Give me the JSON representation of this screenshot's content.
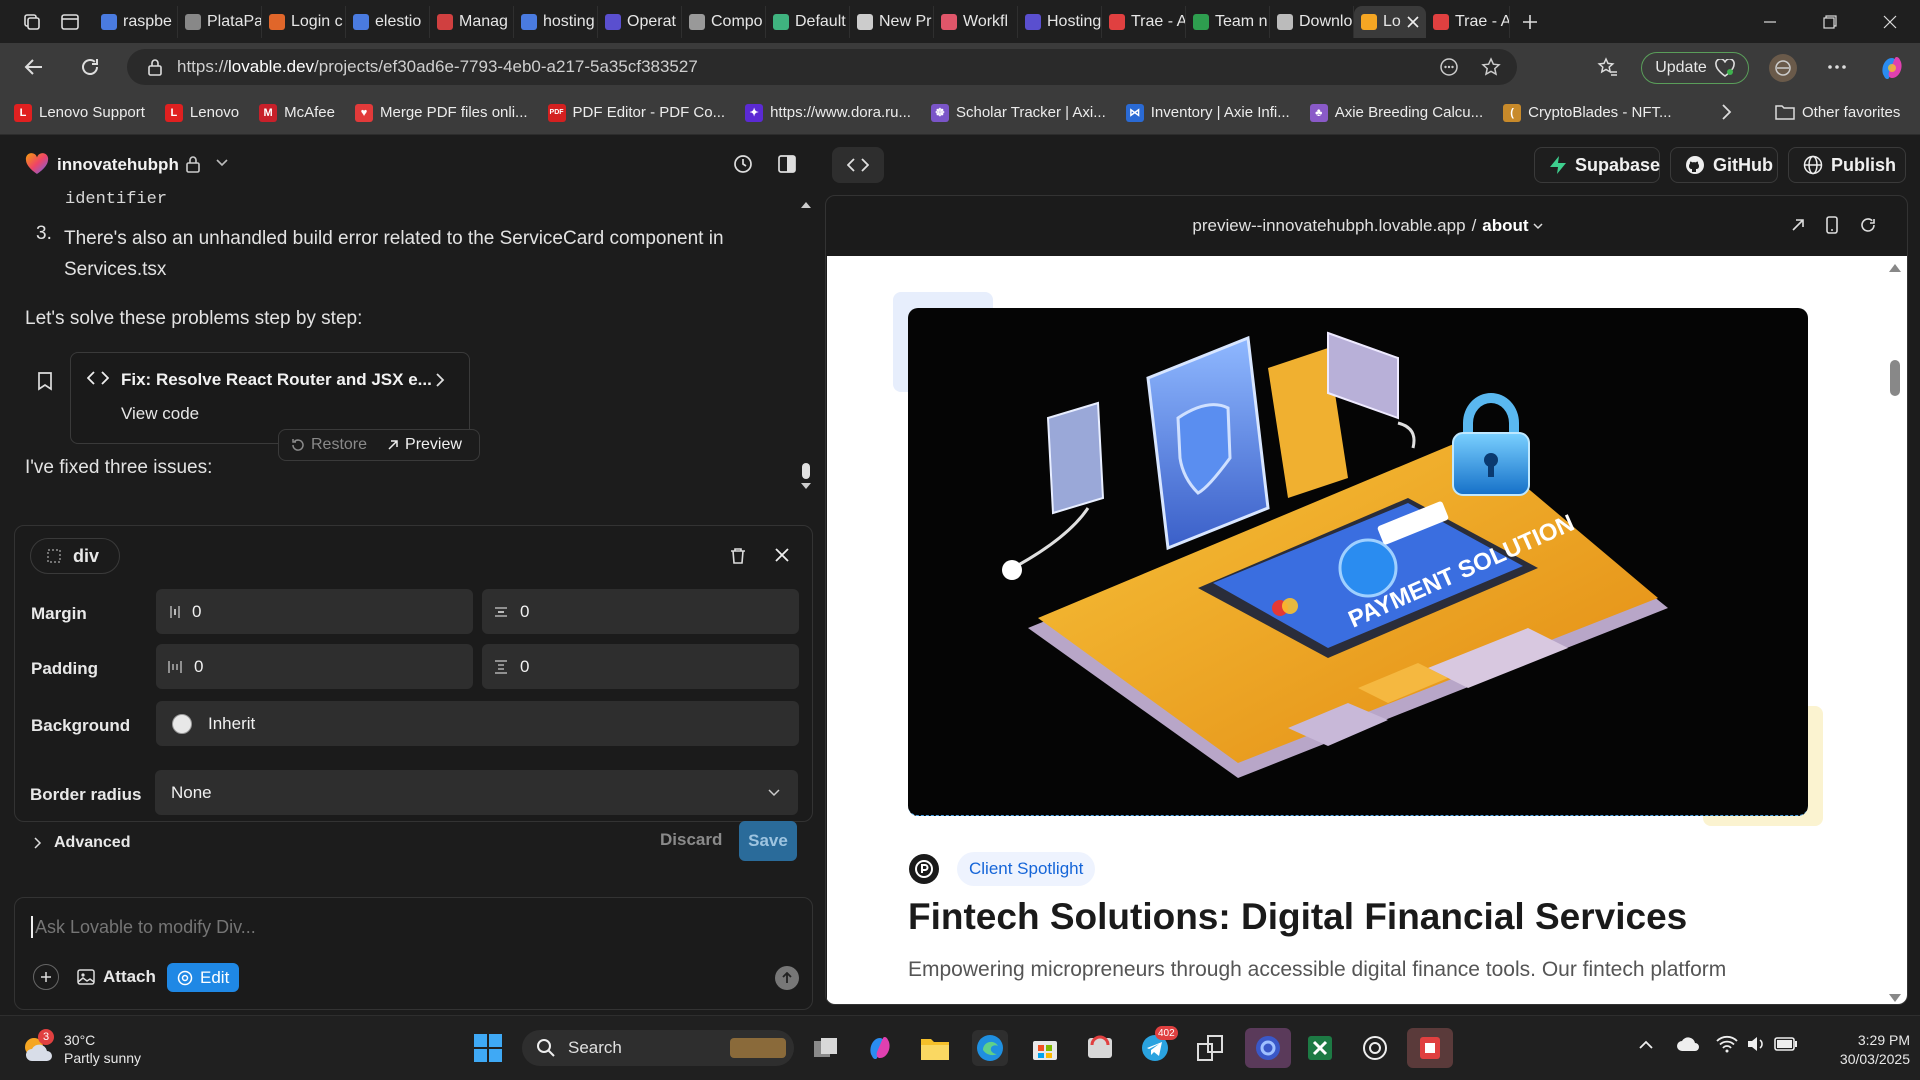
{
  "browser": {
    "tabs": [
      {
        "label": "raspbe",
        "color": "#4a7be0"
      },
      {
        "label": "PlataPa",
        "color": "#888888"
      },
      {
        "label": "Login c",
        "color": "#e0662a"
      },
      {
        "label": "elestio",
        "color": "#4a7be0"
      },
      {
        "label": "Manag",
        "color": "#d04040"
      },
      {
        "label": "hosting",
        "color": "#4a7be0"
      },
      {
        "label": "Operat",
        "color": "#5a4fcf"
      },
      {
        "label": "Compo",
        "color": "#999999"
      },
      {
        "label": "Default",
        "color": "#3fb37f"
      },
      {
        "label": "New Pr",
        "color": "#cccccc"
      },
      {
        "label": "Workfl",
        "color": "#e0566a"
      },
      {
        "label": "Hosting",
        "color": "#5a4fcf"
      },
      {
        "label": "Trae - A",
        "color": "#e04040"
      },
      {
        "label": "Team n",
        "color": "#2e9e4f"
      },
      {
        "label": "Downlo",
        "color": "#bbbbbb"
      },
      {
        "label": "Lo",
        "color": "#f5a623",
        "active": true
      },
      {
        "label": "Trae - A",
        "color": "#e04040"
      }
    ],
    "url": {
      "prefix": "https://",
      "host": "lovable.dev",
      "path": "/projects/ef30ad6e-7793-4eb0-a217-5a35cf383527"
    },
    "update_label": "Update",
    "bookmarks": [
      {
        "label": "Lenovo Support",
        "color": "#e02020",
        "glyph": "L"
      },
      {
        "label": "Lenovo",
        "color": "#e02020",
        "glyph": "L"
      },
      {
        "label": "McAfee",
        "color": "#c8202a",
        "glyph": "M"
      },
      {
        "label": "Merge PDF files onli...",
        "color": "#e23a3a",
        "glyph": "♥"
      },
      {
        "label": "PDF Editor - PDF Co...",
        "color": "#d42020",
        "glyph": "PDF"
      },
      {
        "label": "https://www.dora.ru...",
        "color": "#5b2ad4",
        "glyph": "✦"
      },
      {
        "label": "Scholar Tracker | Axi...",
        "color": "#7a55c8",
        "glyph": "☸"
      },
      {
        "label": "Inventory | Axie Infi...",
        "color": "#2a6ad4",
        "glyph": "⋈"
      },
      {
        "label": "Axie Breeding Calcu...",
        "color": "#8a5ac8",
        "glyph": "♣"
      },
      {
        "label": "CryptoBlades - NFT...",
        "color": "#c88a2a",
        "glyph": "("
      }
    ],
    "other_favorites": "Other favorites"
  },
  "project": {
    "name": "innovatehubph",
    "supabase_label": "Supabase",
    "github_label": "GitHub",
    "publish_label": "Publish"
  },
  "chat": {
    "code_line": "identifier",
    "item_number": "3.",
    "item_text_line1": "There's also an unhandled build error related to the ServiceCard component in",
    "item_text_line2": "Services.tsx",
    "step_text": "Let's solve these problems step by step:",
    "fix_title": "Fix: Resolve React Router and JSX e...",
    "view_code": "View code",
    "restore_label": "Restore",
    "preview_label": "Preview",
    "fixed_text": "I've fixed three issues:"
  },
  "editor": {
    "element_tag": "div",
    "margin_label": "Margin",
    "margin_x": "0",
    "margin_y": "0",
    "padding_label": "Padding",
    "padding_x": "0",
    "padding_y": "0",
    "background_label": "Background",
    "background_value": "Inherit",
    "radius_label": "Border radius",
    "radius_value": "None",
    "advanced_label": "Advanced",
    "discard_label": "Discard",
    "save_label": "Save"
  },
  "prompt": {
    "placeholder": "Ask Lovable to modify Div...",
    "attach_label": "Attach",
    "edit_label": "Edit"
  },
  "preview": {
    "domain": "preview--innovatehubph.lovable.app",
    "separator": "/",
    "route": "about",
    "hero_text": "PAYMENT SOLUTION",
    "tag": "Client Spotlight",
    "headline": "Fintech Solutions: Digital Financial Services",
    "body": "Empowering micropreneurs through accessible digital finance tools. Our fintech platform"
  },
  "taskbar": {
    "weather_temp": "30°C",
    "weather_desc": "Partly sunny",
    "weather_badge": "3",
    "search_label": "Search",
    "telegram_badge": "402",
    "time": "3:29 PM",
    "date": "30/03/2025"
  }
}
